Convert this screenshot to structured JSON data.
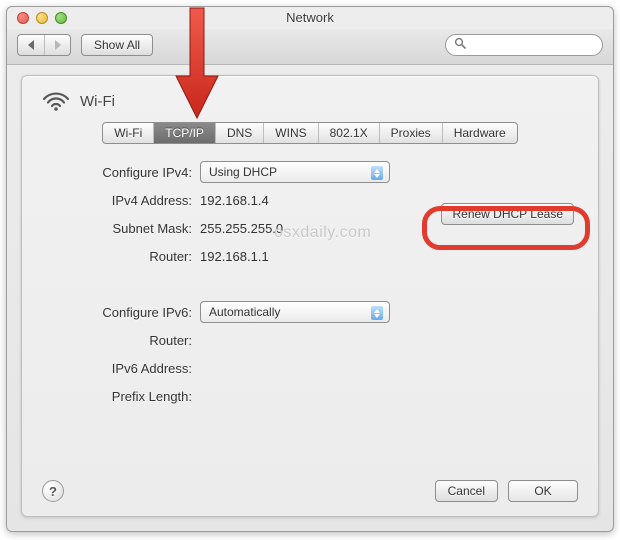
{
  "window": {
    "title": "Network",
    "show_all_label": "Show All",
    "search_placeholder": ""
  },
  "sheet": {
    "connection_name": "Wi-Fi",
    "tabs": [
      "Wi-Fi",
      "TCP/IP",
      "DNS",
      "WINS",
      "802.1X",
      "Proxies",
      "Hardware"
    ],
    "active_tab_index": 1
  },
  "form": {
    "labels": {
      "configure_ipv4": "Configure IPv4:",
      "ipv4_address": "IPv4 Address:",
      "subnet_mask": "Subnet Mask:",
      "router": "Router:",
      "configure_ipv6": "Configure IPv6:",
      "router6": "Router:",
      "ipv6_address": "IPv6 Address:",
      "prefix_length": "Prefix Length:"
    },
    "values": {
      "configure_ipv4": "Using DHCP",
      "ipv4_address": "192.168.1.4",
      "subnet_mask": "255.255.255.0",
      "router": "192.168.1.1",
      "configure_ipv6": "Automatically",
      "router6": "",
      "ipv6_address": "",
      "prefix_length": ""
    },
    "renew_label": "Renew DHCP Lease"
  },
  "footer": {
    "help_label": "?",
    "cancel_label": "Cancel",
    "ok_label": "OK"
  },
  "watermark": "osxdaily.com",
  "annotation": {
    "arrow_color": "#e23b2e"
  }
}
